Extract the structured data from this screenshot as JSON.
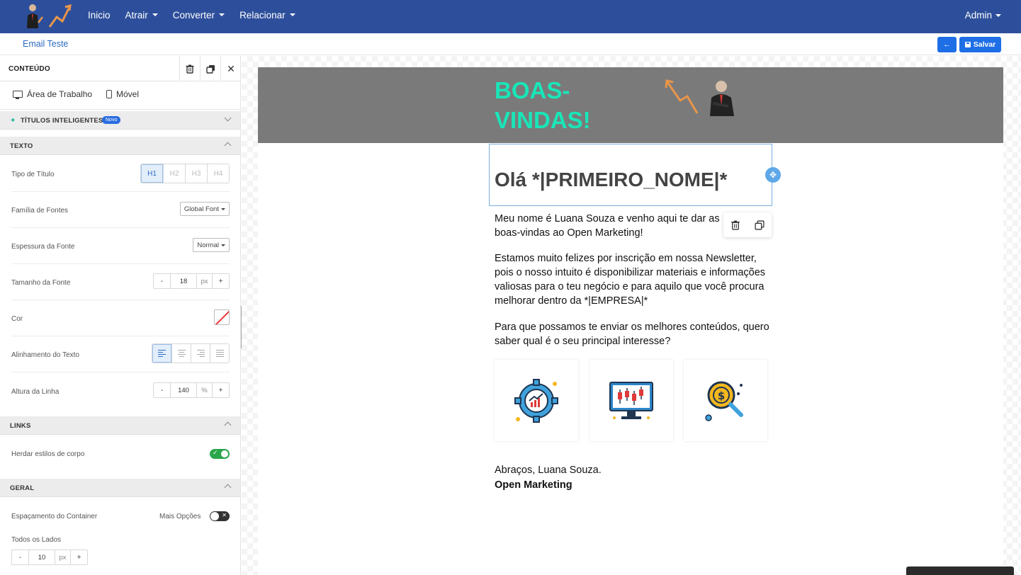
{
  "navbar": {
    "items": [
      {
        "label": "Inicio",
        "has_dropdown": false
      },
      {
        "label": "Atrair",
        "has_dropdown": true
      },
      {
        "label": "Converter",
        "has_dropdown": true
      },
      {
        "label": "Relacionar",
        "has_dropdown": true
      }
    ],
    "user_label": "Admin",
    "background": "#2d4f9b"
  },
  "subbar": {
    "breadcrumb": "Email Teste",
    "back_icon": "arrow-left-icon",
    "save_label": "Salvar",
    "button_color": "#1e6ee6"
  },
  "panel": {
    "title": "CONTEÚDO",
    "tabs": {
      "desktop": "Área de Trabalho",
      "mobile": "Móvel"
    },
    "smart_titles": {
      "label": "TÍTULOS INTELIGENTES",
      "badge": "Novo"
    },
    "text_section": {
      "label": "TEXTO",
      "heading_type": {
        "label": "Tipo de Título",
        "options": [
          "H1",
          "H2",
          "H3",
          "H4"
        ],
        "selected": "H1"
      },
      "font_family": {
        "label": "Família de Fontes",
        "value": "Global Font"
      },
      "font_weight": {
        "label": "Espessura da Fonte",
        "value": "Normal"
      },
      "font_size": {
        "label": "Tamanho da Fonte",
        "value": "18",
        "unit": "px",
        "minus": "-",
        "plus": "+"
      },
      "color": {
        "label": "Cor"
      },
      "text_align": {
        "label": "Alinhamento do Texto",
        "selected": "left"
      },
      "line_height": {
        "label": "Altura da Linha",
        "value": "140",
        "unit": "%",
        "minus": "-",
        "plus": "+"
      }
    },
    "links_section": {
      "label": "LINKS",
      "inherit": {
        "label": "Herdar estilos de corpo",
        "enabled": true
      }
    },
    "general_section": {
      "label": "GERAL",
      "container_padding": {
        "label": "Espaçamento do Container",
        "more_options": "Mais Opções",
        "more_enabled": false
      },
      "all_sides": {
        "label": "Todos os Lados",
        "value": "10",
        "unit": "px",
        "minus": "-",
        "plus": "+"
      }
    }
  },
  "email": {
    "header_background": "#7a7a7a",
    "welcome": "BOAS-VINDAS!",
    "welcome_color": "#19e6b8",
    "greeting": "Olá *|PRIMEIRO_NOME|*",
    "paragraph1": "Meu nome é Luana Souza e venho aqui te dar as boas-vindas ao Open Marketing!",
    "paragraph2": "Estamos muito felizes por inscrição em nossa Newsletter, pois o nosso intuito é disponibilizar materiais e informações valiosas para o teu negócio e para aquilo que você procura melhorar dentro da *|EMPRESA|*",
    "paragraph3": "Para que possamos te enviar os melhores conteúdos, quero saber qual é o seu principal interesse?",
    "cards": [
      "gear-growth-icon",
      "monitor-candlestick-icon",
      "magnifier-dollar-icon"
    ],
    "signature": "Abraços, Luana Souza.",
    "company": "Open Marketing"
  }
}
